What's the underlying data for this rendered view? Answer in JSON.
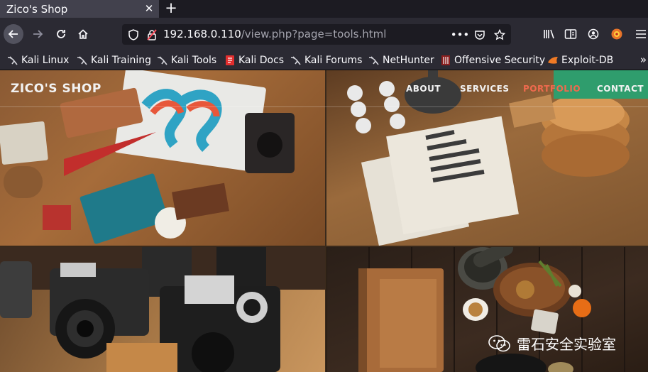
{
  "browser": {
    "tab": {
      "title": "Zico's Shop",
      "close_icon": "close-icon"
    },
    "new_tab_icon": "plus-icon",
    "nav": {
      "back_icon": "arrow-left-icon",
      "forward_icon": "arrow-right-icon",
      "reload_icon": "reload-icon",
      "home_icon": "home-icon"
    },
    "url": {
      "host": "192.168.0.110",
      "path": "/view.php?page=tools.html",
      "security_icon": "shield-icon",
      "insecure_icon": "insecure-lock-icon",
      "page_actions_icon": "more-horizontal-icon",
      "pocket_icon": "pocket-icon",
      "bookmark_icon": "star-icon"
    },
    "toolbar_icons": [
      "library-icon",
      "reader-view-icon",
      "account-icon",
      "extension-icon",
      "menu-icon"
    ],
    "bookmarks": [
      {
        "label": "Kali Linux",
        "icon": "kali-dragon-icon"
      },
      {
        "label": "Kali Training",
        "icon": "kali-dragon-icon"
      },
      {
        "label": "Kali Tools",
        "icon": "kali-dragon-icon"
      },
      {
        "label": "Kali Docs",
        "icon": "kali-docs-icon"
      },
      {
        "label": "Kali Forums",
        "icon": "kali-dragon-icon"
      },
      {
        "label": "NetHunter",
        "icon": "kali-dragon-icon"
      },
      {
        "label": "Offensive Security",
        "icon": "offsec-icon"
      },
      {
        "label": "Exploit-DB",
        "icon": "exploit-db-icon"
      }
    ],
    "bookmarks_overflow_icon": "chevron-double-right-icon"
  },
  "site": {
    "logo": "ZICO'S SHOP",
    "nav": [
      "ABOUT",
      "SERVICES",
      "PORTFOLIO",
      "CONTACT"
    ],
    "active_nav": "PORTFOLIO",
    "accent_color": "#ef6a4e"
  },
  "watermark": {
    "text": "雷石安全实验室",
    "icon": "wechat-icon"
  }
}
